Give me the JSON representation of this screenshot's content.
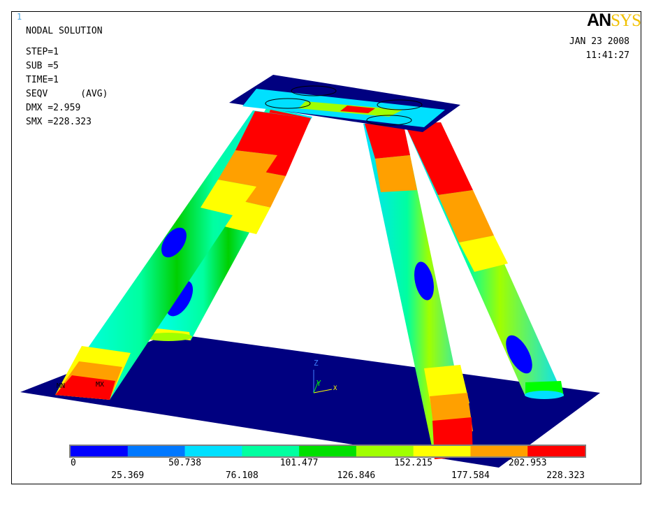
{
  "window_number": "1",
  "logo": {
    "part1": "AN",
    "part2": "SYS"
  },
  "info": {
    "title": "NODAL SOLUTION",
    "step": "STEP=1",
    "sub": "SUB =5",
    "time": "TIME=1",
    "result": "SEQV      (AVG)",
    "dmx": "DMX =2.959",
    "smx": "SMX =228.323"
  },
  "date": "JAN 23 2008",
  "clock": "11:41:27",
  "markers": {
    "mn": "MN",
    "mx": "MX"
  },
  "triad": {
    "z": "Z",
    "y": "Y",
    "x": "X"
  },
  "legend": {
    "colors": [
      "#0000ff",
      "#0078ff",
      "#00e0ff",
      "#00ffa0",
      "#00e000",
      "#a0ff00",
      "#ffff00",
      "#ffa000",
      "#ff0000"
    ],
    "labels_bottom": [
      "0",
      "50.738",
      "101.477",
      "152.215",
      "202.953"
    ],
    "labels_top": [
      "25.369",
      "76.108",
      "126.846",
      "177.584",
      "228.323"
    ]
  },
  "colors": {
    "base": "#000080",
    "background": "#ffffff"
  }
}
